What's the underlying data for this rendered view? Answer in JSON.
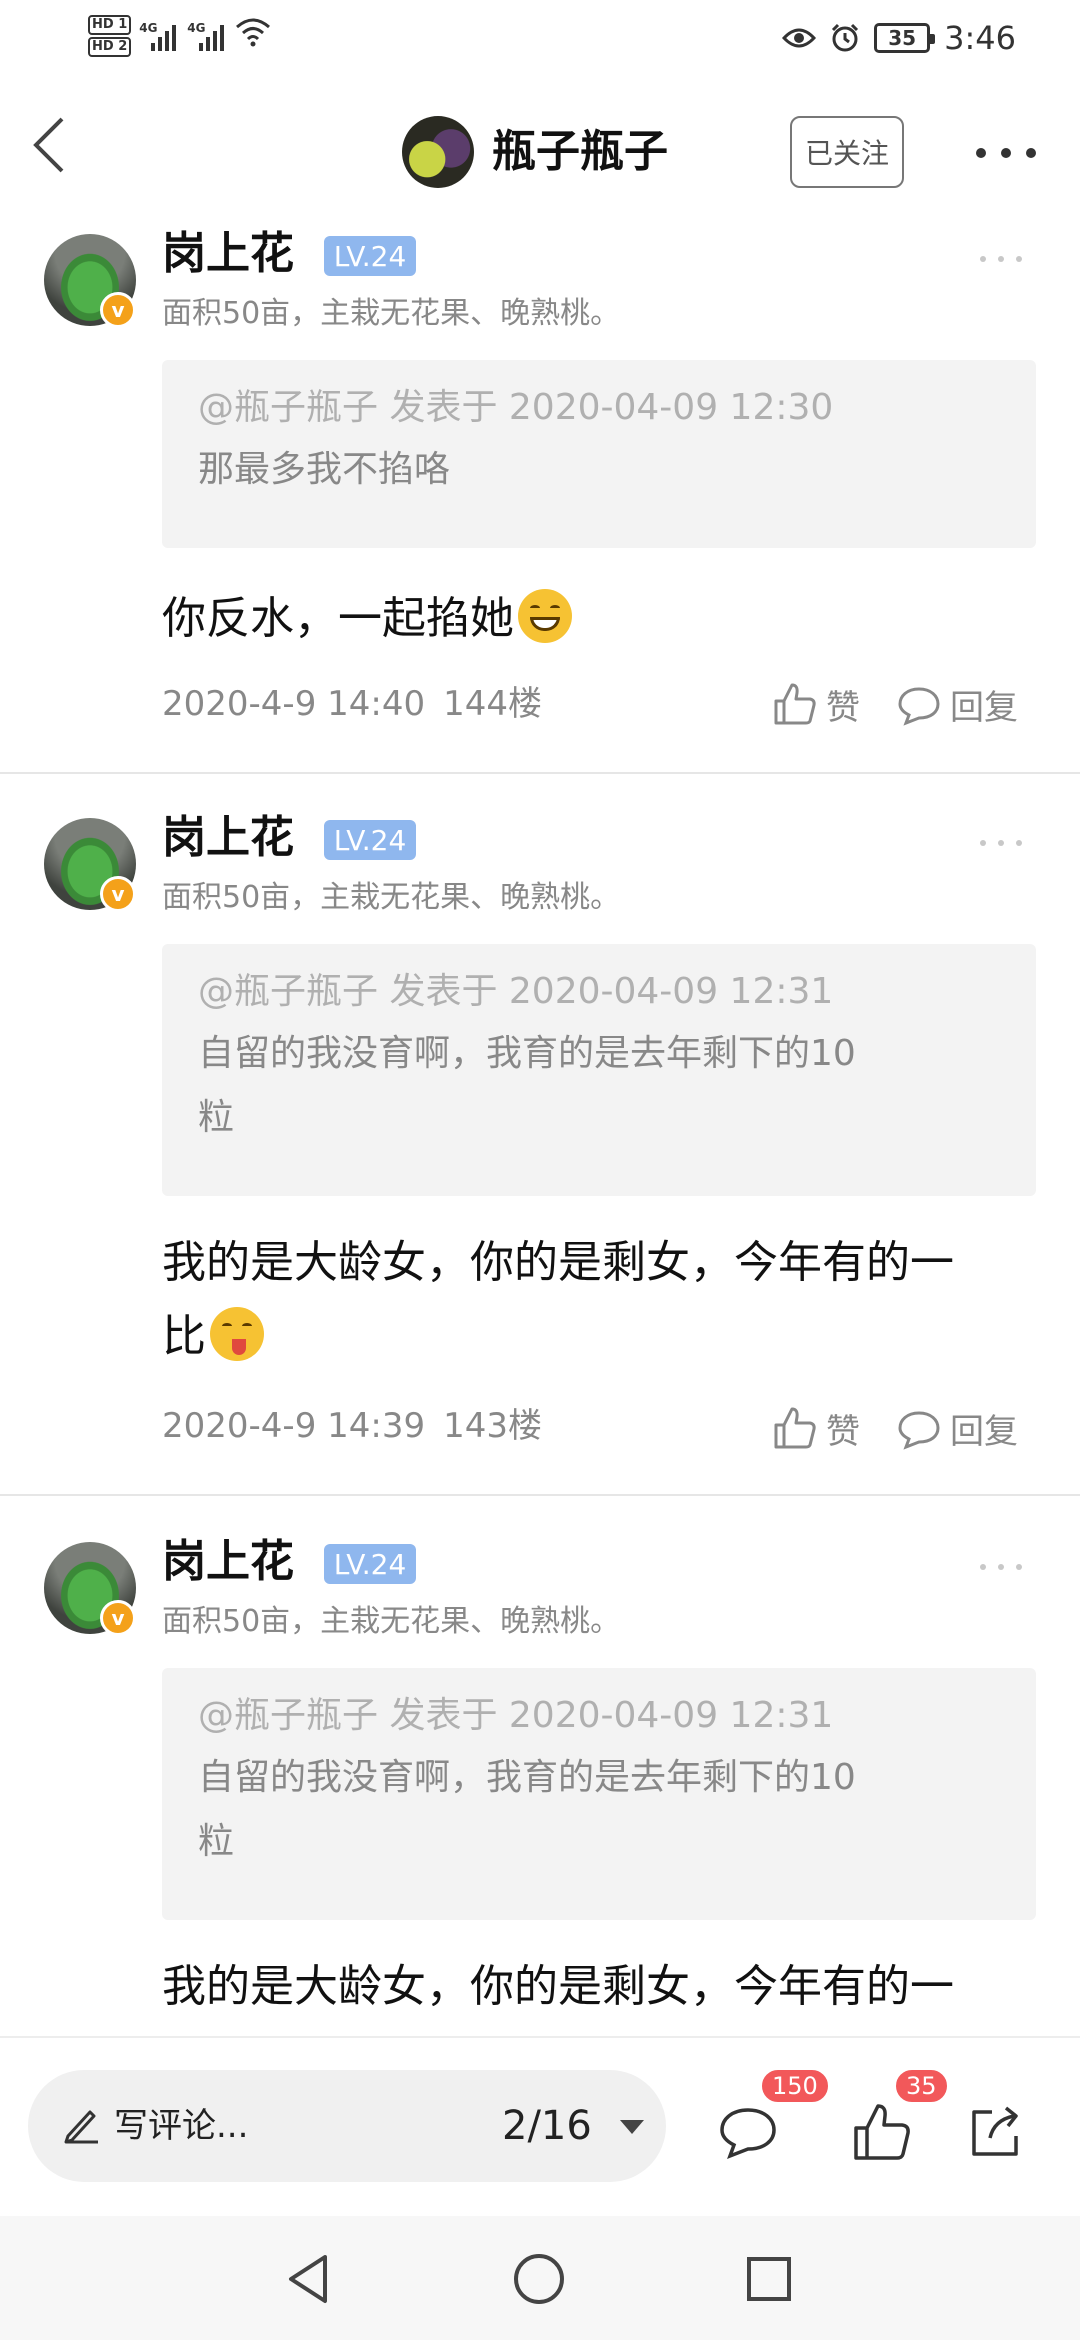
{
  "status_bar": {
    "hd1": "HD 1",
    "hd2": "HD 2",
    "net1": "4G",
    "net2": "4G",
    "battery": "35",
    "time": "3:46"
  },
  "header": {
    "title": "瓶子瓶子",
    "follow_label": "已关注"
  },
  "posts": [
    {
      "user": "岗上花",
      "level": "LV.24",
      "bio": "面积50亩，主栽无花果、晚熟桃。",
      "quote_head": "@瓶子瓶子 发表于 2020-04-09 12:30",
      "quote_text": "那最多我不掐咯",
      "content": "你反水，一起掐她",
      "emoji": "grin-emoji",
      "time": "2020-4-9 14:40",
      "floor": "144楼",
      "like_label": "赞",
      "reply_label": "回复"
    },
    {
      "user": "岗上花",
      "level": "LV.24",
      "bio": "面积50亩，主栽无花果、晚熟桃。",
      "quote_head": "@瓶子瓶子 发表于 2020-04-09 12:31",
      "quote_text_line1": "自留的我没育啊，我育的是去年剩下的10",
      "quote_text_line2": "粒",
      "content_line1": "我的是大龄女，你的是剩女，今年有的一",
      "content_line2": "比",
      "emoji": "tongue-emoji",
      "time": "2020-4-9 14:39",
      "floor": "143楼",
      "like_label": "赞",
      "reply_label": "回复"
    },
    {
      "user": "岗上花",
      "level": "LV.24",
      "bio": "面积50亩，主栽无花果、晚熟桃。",
      "quote_head": "@瓶子瓶子 发表于 2020-04-09 12:31",
      "quote_text_line1": "自留的我没育啊，我育的是去年剩下的10",
      "quote_text_line2": "粒",
      "content_line1": "我的是大龄女，你的是剩女，今年有的一"
    }
  ],
  "bottom_bar": {
    "comment_placeholder": "写评论...",
    "pager": "2/16",
    "comment_count": "150",
    "like_count": "35"
  },
  "colors": {
    "level_badge": "#8fb7ee",
    "verified_badge": "#f4a11a",
    "count_badge": "#f2585a"
  }
}
